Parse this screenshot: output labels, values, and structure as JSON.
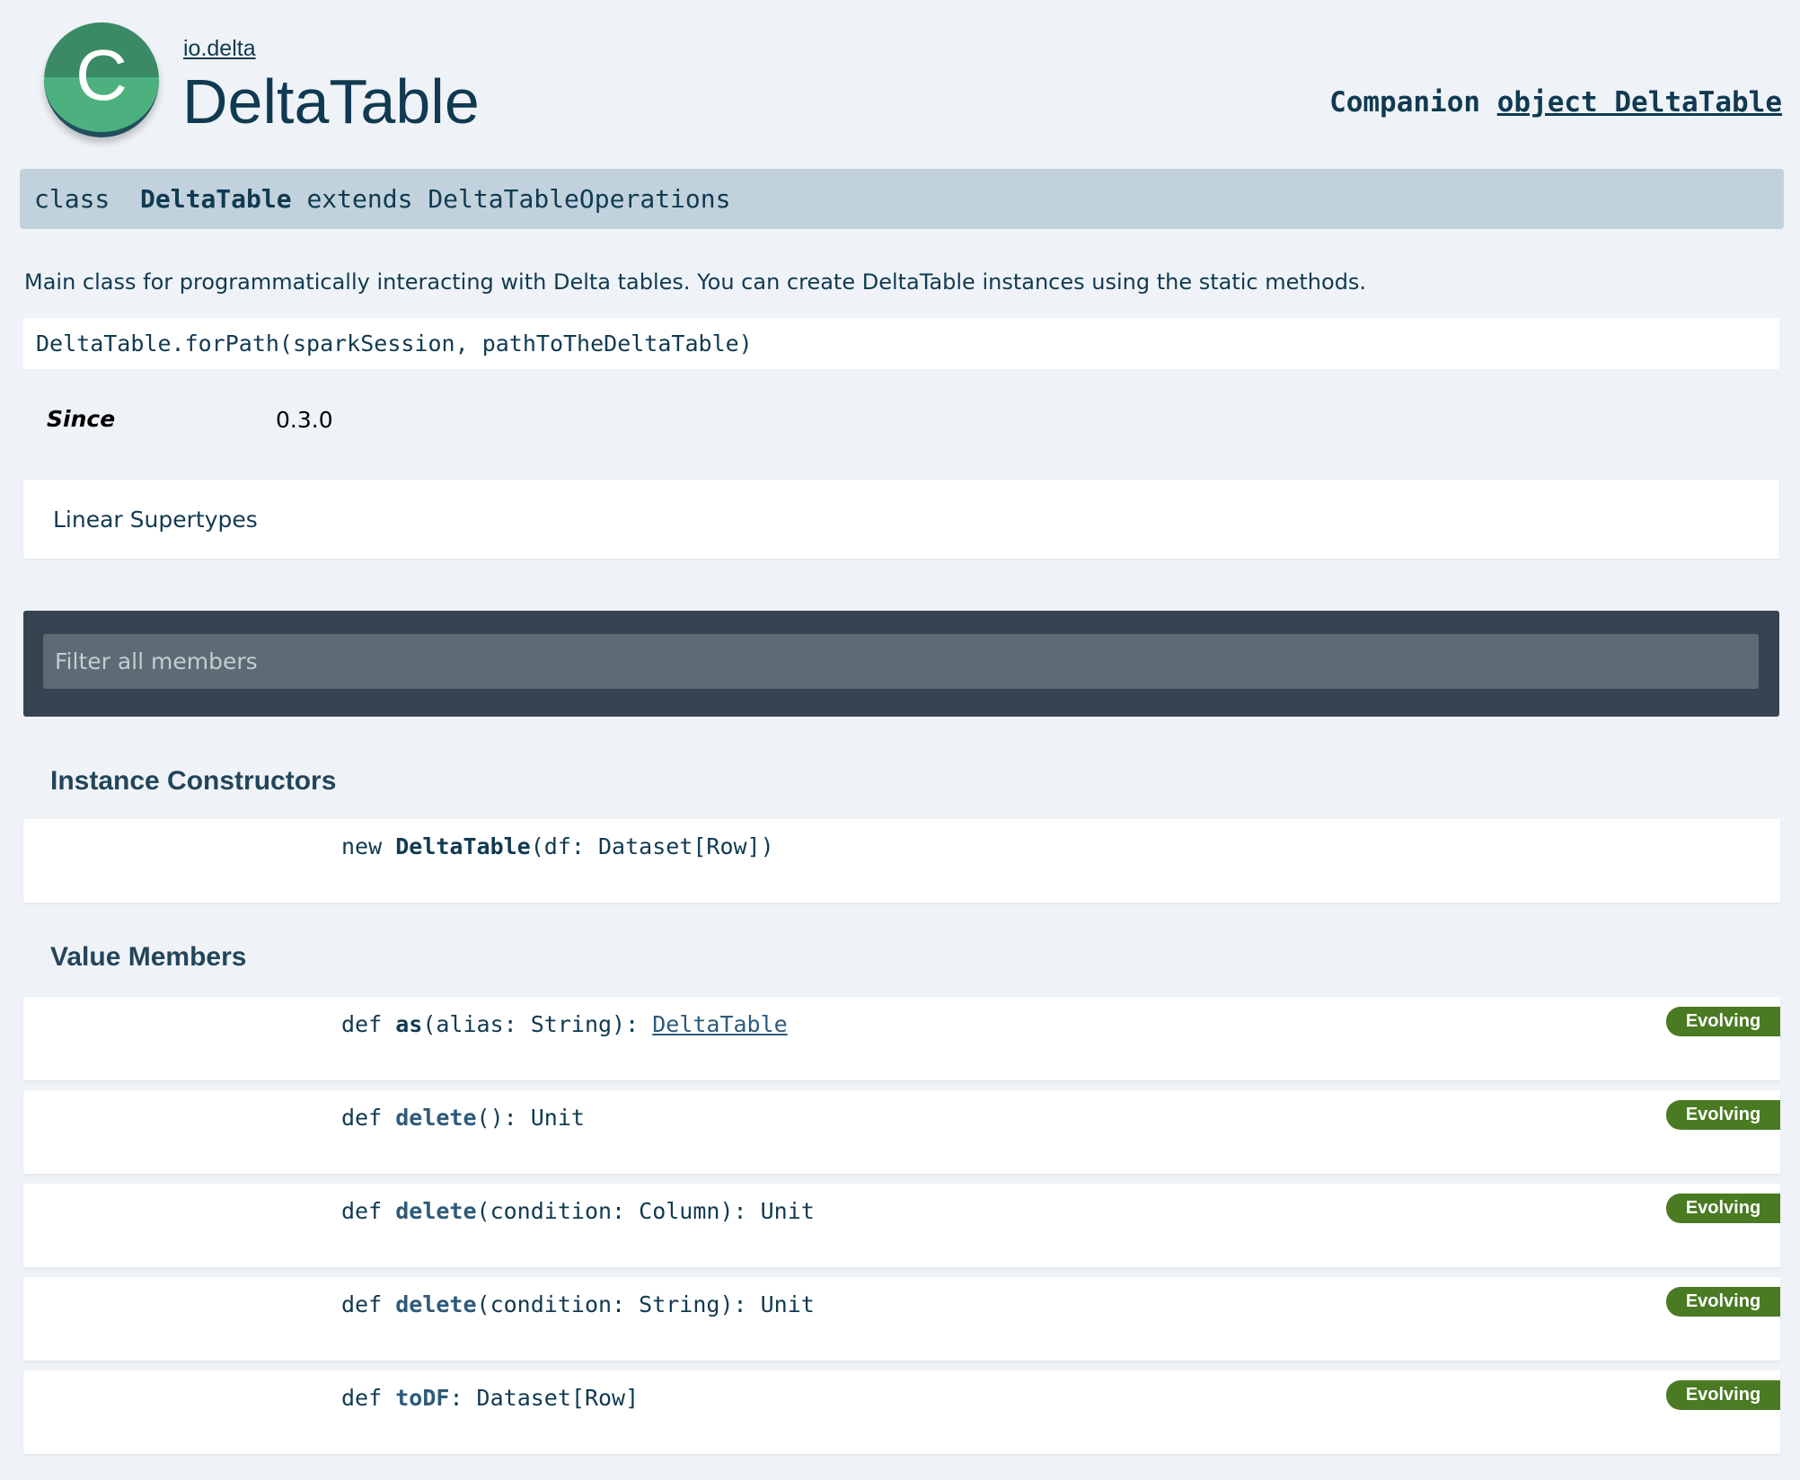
{
  "header": {
    "icon_letter": "C",
    "package": "io.delta",
    "title": "DeltaTable",
    "companion_label": "Companion",
    "companion_link": "object DeltaTable"
  },
  "signature": {
    "kind": "class",
    "name": "DeltaTable",
    "extends_kw": "extends",
    "parent": "DeltaTableOperations"
  },
  "description": "Main class for programmatically interacting with Delta tables. You can create DeltaTable instances using the static methods.",
  "code_example": "DeltaTable.forPath(sparkSession, pathToTheDeltaTable)",
  "since": {
    "label": "Since",
    "value": "0.3.0"
  },
  "linear_supertypes": "Linear Supertypes",
  "filter": {
    "placeholder": "Filter all members"
  },
  "sections": {
    "constructors_title": "Instance Constructors",
    "members_title": "Value Members"
  },
  "constructor": {
    "kw": "new",
    "name": "DeltaTable",
    "params": "(df: Dataset[Row])"
  },
  "members": [
    {
      "kw": "def",
      "name": "as",
      "params": "(alias: String): ",
      "return_link": "DeltaTable",
      "badge": "Evolving"
    },
    {
      "kw": "def",
      "name": "delete",
      "params": "(): Unit",
      "badge": "Evolving"
    },
    {
      "kw": "def",
      "name": "delete",
      "params": "(condition: Column): Unit",
      "badge": "Evolving"
    },
    {
      "kw": "def",
      "name": "delete",
      "params": "(condition: String): Unit",
      "badge": "Evolving"
    },
    {
      "kw": "def",
      "name": "toDF",
      "params": ": Dataset[Row]",
      "badge": "Evolving"
    }
  ],
  "colors": {
    "background": "#eff3f7",
    "text": "#103a51",
    "signature_bar": "#c2d2dc",
    "filter_panel": "#364452",
    "badge": "#4a7a22",
    "icon_green": "#4db07f"
  }
}
